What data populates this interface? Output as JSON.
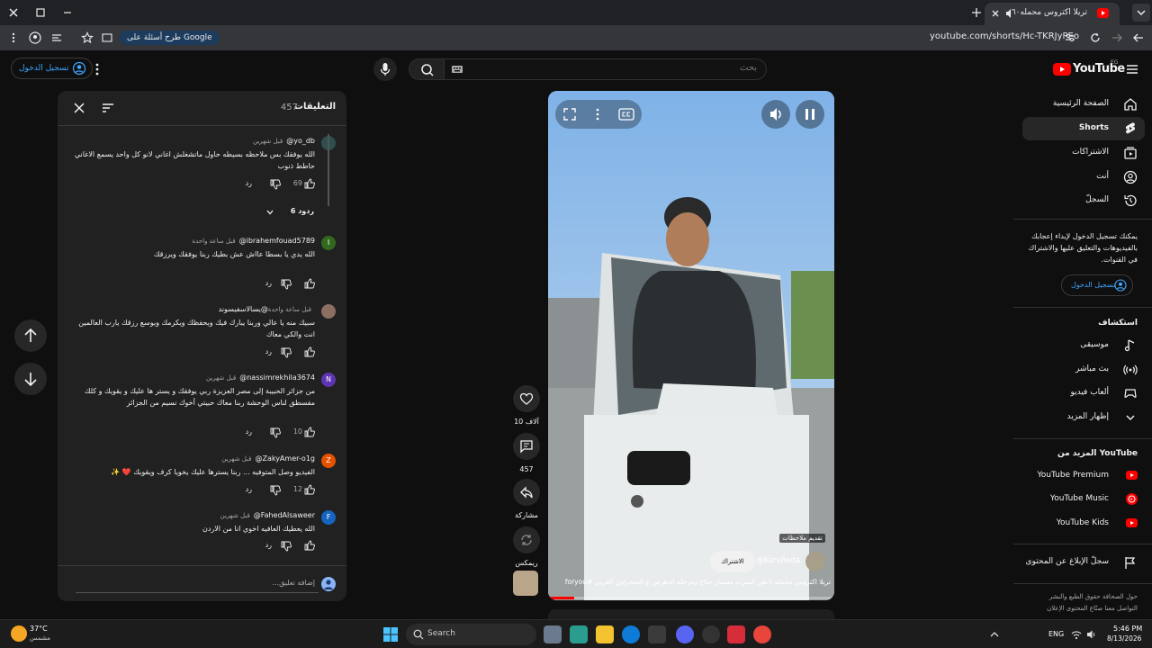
{
  "browser": {
    "tab_title": "تريلا اكتروس محمله٦٠طن ك...",
    "url": "youtube.com/shorts/Hc-TKRJyPEo",
    "ask_google": "طرح أسئلة على Google"
  },
  "header": {
    "logo_text": "YouTube",
    "country_code": "EG",
    "search_placeholder": "بحث",
    "signin_label": "تسجيل الدخول"
  },
  "sidebar": {
    "items": [
      {
        "label": "الصفحة الرئيسية",
        "icon": "home-icon"
      },
      {
        "label": "Shorts",
        "icon": "shorts-icon"
      },
      {
        "label": "الاشتراكات",
        "icon": "subscriptions-icon"
      },
      {
        "label": "أنت",
        "icon": "you-icon"
      },
      {
        "label": "السجلّ",
        "icon": "history-icon"
      }
    ],
    "signin_prompt": "يمكنك تسجيل الدخول لإبداء إعجابك بالفيديوهات والتعليق عليها والاشتراك في القنوات.",
    "signin_button": "تسجيل الدخول",
    "explore_title": "استكشاف",
    "explore": [
      {
        "label": "موسيقى",
        "icon": "music-icon"
      },
      {
        "label": "بث مباشر",
        "icon": "live-icon"
      },
      {
        "label": "ألعاب فيديو",
        "icon": "gaming-icon"
      },
      {
        "label": "إظهار المزيد",
        "icon": "chevron-down-icon"
      }
    ],
    "more_title": "المزيد من YouTube",
    "more": [
      {
        "label": "YouTube Premium"
      },
      {
        "label": "YouTube Music"
      },
      {
        "label": "YouTube Kids"
      }
    ],
    "report_history": "سجلّ الإبلاغ عن المحتوى",
    "footer_line1": "حول  الصحافة  حقوق الطبع والنشر",
    "footer_line2": "التواصل معنا  صنّاع المحتوى  الإعلان"
  },
  "comments": {
    "title": "التعليقات",
    "count": "457",
    "add_placeholder": "إضافة تعليق...",
    "items": [
      {
        "author": "@yo_db",
        "time": "قبل شهرين",
        "text": "الله يوفقك بس ملاحظه بسيطه حاول ماتشغلش اغاني لانو كل واحد يسمع الاغاني حاطط ذنوب",
        "likes": "69",
        "reply": "رد",
        "avatar": "",
        "avatar_color": "#2f4f4f",
        "replies_label": "6 ردود"
      },
      {
        "author": "@ibrahemfouad5789",
        "time": "قبل ساعة واحدة",
        "text": "الله يدي يا بسطا عااش عش بطيك ربنا يوفقك ويرزقك",
        "likes": "",
        "reply": "رد",
        "avatar": "I",
        "avatar_color": "#33691e"
      },
      {
        "author": "@يسالاسفيسوند",
        "time": "قبل ساعة واحدة",
        "text": "سبيك منه يا عالي وربنا يبارك فيك ويحفظك ويكرمك ويوسع رزقك يارب العالمين انت والكي معاك",
        "likes": "",
        "reply": "رد",
        "avatar": "",
        "avatar_color": "#8d6e63"
      },
      {
        "author": "@nassimrekhila3674",
        "time": "قبل شهرين",
        "text": "من جزائر الحبيبة إلى مصر العزيزة ربي يوفقك و يستر ها عليك و يقويك و كلك مفسطق لناس الوحشة ربنا معاك حبيتي أخوك نسيم من الجزائر",
        "likes": "10",
        "reply": "رد",
        "avatar": "N",
        "avatar_color": "#5e35b1"
      },
      {
        "author": "@ZakyAmer-o1g",
        "time": "قبل شهرين",
        "text": "الفيديو وصل المتوفيه ... ربنا يسترها عليك يخويا كرف ويقويك ❤️ ✨",
        "likes": "12",
        "reply": "رد",
        "avatar": "Z",
        "avatar_color": "#e65100"
      },
      {
        "author": "@FahedAlsaweer",
        "time": "قبل شهرين",
        "text": "الله يعطيك العافيه اخوي انا من الاردن",
        "likes": "",
        "reply": "رد",
        "avatar": "F",
        "avatar_color": "#1565c0"
      }
    ]
  },
  "video": {
    "channel": "@KarvReda",
    "subscribe": "الاشتراك",
    "badge": "تقديم ملاحظات",
    "title": "تريلا اكتروس محمله٦٠طن كسرت مسمار جناح ومرحله الدهرس ع السحراوي الغربي #foryou",
    "progress": 0.09
  },
  "actions": {
    "likes": "10 آلاف",
    "comments": "457",
    "share": "مشاركة",
    "remix": "ريمكس"
  },
  "taskbar": {
    "weather_temp": "37°C",
    "weather_desc": "مشمس",
    "search_label": "Search",
    "lang": "ENG",
    "time": "5:46 PM",
    "date": "8/13/2026"
  },
  "colors": {
    "accent": "#3ea6ff",
    "brand": "#ff0000",
    "bg": "#0f0f0f"
  }
}
